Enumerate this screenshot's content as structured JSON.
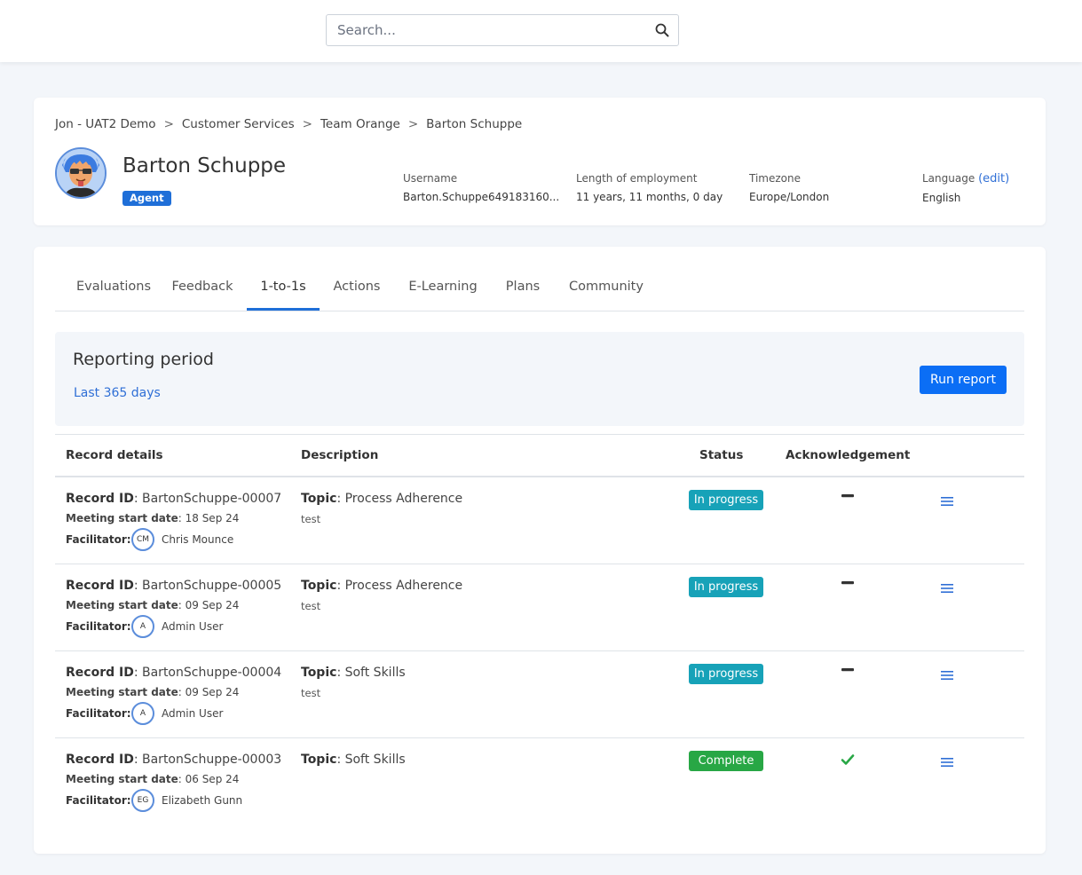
{
  "search": {
    "placeholder": "Search..."
  },
  "breadcrumb": [
    "Jon - UAT2 Demo",
    "Customer Services",
    "Team Orange",
    "Barton Schuppe"
  ],
  "breadcrumb_separator": ">",
  "profile": {
    "name": "Barton Schuppe",
    "role": "Agent",
    "username_label": "Username",
    "username": "Barton.Schuppe649183160...",
    "employment_label": "Length of employment",
    "employment": "11 years, 11 months, 0 day",
    "timezone_label": "Timezone",
    "timezone": "Europe/London",
    "language_label": "Language",
    "language_edit": "(edit)",
    "language": "English"
  },
  "tabs": [
    {
      "label": "Evaluations",
      "active": false
    },
    {
      "label": "Feedback",
      "active": false
    },
    {
      "label": "1-to-1s",
      "active": true
    },
    {
      "label": "Actions",
      "active": false
    },
    {
      "label": "E-Learning",
      "active": false
    },
    {
      "label": "Plans",
      "active": false
    },
    {
      "label": "Community",
      "active": false
    }
  ],
  "reporting": {
    "title": "Reporting period",
    "period": "Last 365 days",
    "run_label": "Run report"
  },
  "table": {
    "headers": {
      "record": "Record details",
      "description": "Description",
      "status": "Status",
      "ack": "Acknowledgement"
    },
    "labels": {
      "record_id": "Record ID",
      "meeting_start": "Meeting start date",
      "facilitator": "Facilitator:",
      "topic": "Topic"
    },
    "rows": [
      {
        "record_id": "BartonSchuppe-00007",
        "meeting_date": "18 Sep 24",
        "facilitator_initials": "CM",
        "facilitator": "Chris Mounce",
        "topic": "Process Adherence",
        "description": "test",
        "status": "In progress",
        "status_color": "#17a2b8",
        "ack": "dash-icon"
      },
      {
        "record_id": "BartonSchuppe-00005",
        "meeting_date": "09 Sep 24",
        "facilitator_initials": "A",
        "facilitator": "Admin User",
        "topic": "Process Adherence",
        "description": "test",
        "status": "In progress",
        "status_color": "#17a2b8",
        "ack": "dash-icon"
      },
      {
        "record_id": "BartonSchuppe-00004",
        "meeting_date": "09 Sep 24",
        "facilitator_initials": "A",
        "facilitator": "Admin User",
        "topic": "Soft Skills",
        "description": "test",
        "status": "In progress",
        "status_color": "#17a2b8",
        "ack": "dash-icon"
      },
      {
        "record_id": "BartonSchuppe-00003",
        "meeting_date": "06 Sep 24",
        "facilitator_initials": "EG",
        "facilitator": "Elizabeth Gunn",
        "topic": "Soft Skills",
        "description": "",
        "status": "Complete",
        "status_color": "#28a745",
        "ack": "check-icon"
      }
    ]
  },
  "colors": {
    "primary": "#0b6ef5",
    "link": "#2f6fd6",
    "in_progress": "#17a2b8",
    "complete": "#28a745"
  }
}
